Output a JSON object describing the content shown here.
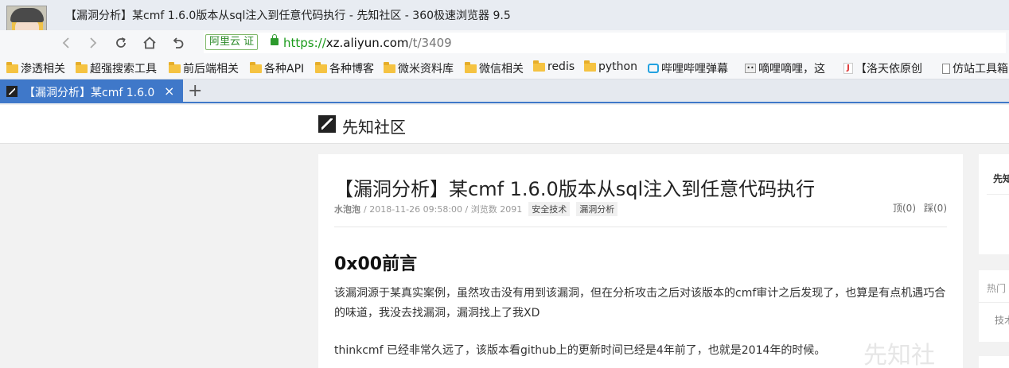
{
  "window": {
    "title": "【漏洞分析】某cmf 1.6.0版本从sql注入到任意代码执行 - 先知社区 - 360极速浏览器 9.5"
  },
  "navbar": {
    "site_badge": "阿里云 证",
    "url_scheme": "https://",
    "url_host": "xz.aliyun.com",
    "url_path": "/t/3409"
  },
  "bookmarks": [
    {
      "label": "渗透相关",
      "icon": "folder-icon"
    },
    {
      "label": "超强搜索工具",
      "icon": "folder-icon"
    },
    {
      "label": "前后端相关",
      "icon": "folder-icon"
    },
    {
      "label": "各种API",
      "icon": "folder-icon"
    },
    {
      "label": "各种博客",
      "icon": "folder-icon"
    },
    {
      "label": "微米资料库",
      "icon": "folder-icon"
    },
    {
      "label": "微信相关",
      "icon": "folder-icon"
    },
    {
      "label": "redis",
      "icon": "folder-icon"
    },
    {
      "label": "python",
      "icon": "folder-icon"
    },
    {
      "label": "哔哩哔哩弹幕",
      "icon": "bilibili-icon"
    },
    {
      "label": "嘀哩嘀哩，这",
      "icon": "emoticon-icon"
    },
    {
      "label": "【洛天依原创",
      "icon": "j-icon"
    },
    {
      "label": "仿站工具箱",
      "icon": "page-icon"
    }
  ],
  "tabs": {
    "active_title": "【漏洞分析】某cmf 1.6.0",
    "close_glyph": "×",
    "new_tab_glyph": "+"
  },
  "site": {
    "logo_text": "先知社区"
  },
  "article": {
    "title": "【漏洞分析】某cmf 1.6.0版本从sql注入到任意代码执行",
    "author": "水泡泡",
    "meta": "/ 2018-11-26 09:58:00 / 浏览数 2091",
    "tags": [
      "安全技术",
      "漏洞分析"
    ],
    "upvote": "顶(0)",
    "downvote": "踩(0)",
    "section_heading": "0x00前言",
    "paragraph1": "该漏洞源于某真实案例，虽然攻击没有用到该漏洞，但在分析攻击之后对该版本的cmf审计之后发现了，也算是有点机遇巧合的味道，我没去找漏洞，漏洞找上了我XD",
    "paragraph2": "thinkcmf 已经非常久远了，该版本看github上的更新时间已经是4年前了，也就是2014年的时候。"
  },
  "watermark": "先知社",
  "sidebar": {
    "card1_title": "先知",
    "card2_title": "热门",
    "card2_item": "技术"
  }
}
